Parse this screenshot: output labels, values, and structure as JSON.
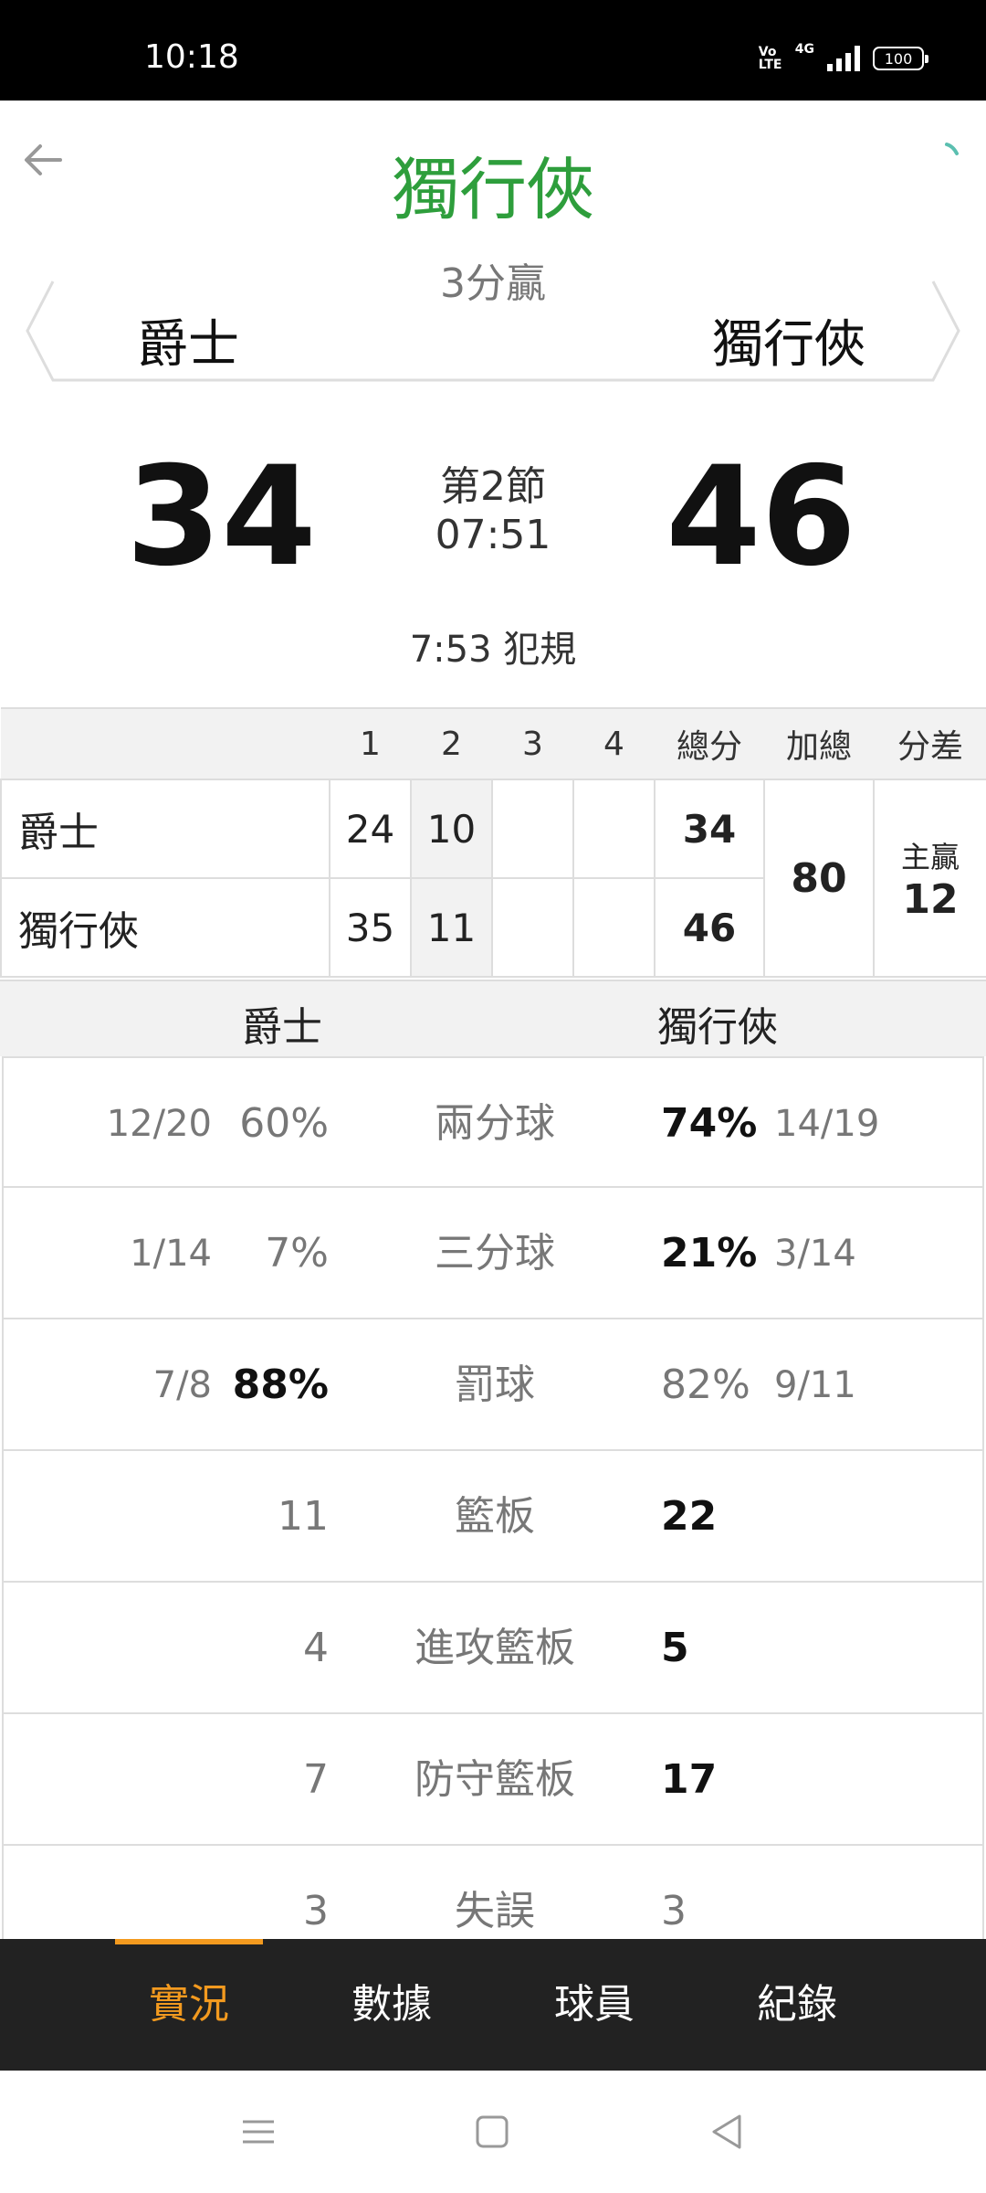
{
  "status_bar": {
    "time": "10:18",
    "volte": "Vo LTE",
    "network": "4G",
    "battery": "100"
  },
  "header": {
    "title": "獨行俠",
    "subtitle": "3分贏",
    "home_team": "爵士",
    "away_team": "獨行俠"
  },
  "scoreboard": {
    "home_score": "34",
    "away_score": "46",
    "period": "第2節",
    "clock": "07:51",
    "last_play": "7:53 犯規"
  },
  "quarters": {
    "columns": [
      "1",
      "2",
      "3",
      "4",
      "總分",
      "加總",
      "分差"
    ],
    "rows": [
      {
        "team": "爵士",
        "q1": "24",
        "q2": "10",
        "q3": "",
        "q4": "",
        "total": "34"
      },
      {
        "team": "獨行俠",
        "q1": "35",
        "q2": "11",
        "q3": "",
        "q4": "",
        "total": "46"
      }
    ],
    "combined_total": "80",
    "diff_label": "主贏",
    "diff_value": "12"
  },
  "stats": {
    "home_team": "爵士",
    "away_team": "獨行俠",
    "rows": [
      {
        "label": "兩分球",
        "home_frac": "12/20",
        "home_val": "60%",
        "away_val": "74%",
        "away_frac": "14/19",
        "leader": "away"
      },
      {
        "label": "三分球",
        "home_frac": "1/14",
        "home_val": "7%",
        "away_val": "21%",
        "away_frac": "3/14",
        "leader": "away"
      },
      {
        "label": "罰球",
        "home_frac": "7/8",
        "home_val": "88%",
        "away_val": "82%",
        "away_frac": "9/11",
        "leader": "home"
      },
      {
        "label": "籃板",
        "home_frac": "",
        "home_val": "11",
        "away_val": "22",
        "away_frac": "",
        "leader": "away"
      },
      {
        "label": "進攻籃板",
        "home_frac": "",
        "home_val": "4",
        "away_val": "5",
        "away_frac": "",
        "leader": "away"
      },
      {
        "label": "防守籃板",
        "home_frac": "",
        "home_val": "7",
        "away_val": "17",
        "away_frac": "",
        "leader": "away"
      },
      {
        "label": "失誤",
        "home_frac": "",
        "home_val": "3",
        "away_val": "3",
        "away_frac": "",
        "leader": "none"
      }
    ]
  },
  "tabs": [
    {
      "label": "實況",
      "active": true
    },
    {
      "label": "數據",
      "active": false
    },
    {
      "label": "球員",
      "active": false
    },
    {
      "label": "紀錄",
      "active": false
    }
  ],
  "colors": {
    "title_green": "#2e9e3c",
    "tab_active": "#f39a1f",
    "tabbar_bg": "#222222"
  }
}
